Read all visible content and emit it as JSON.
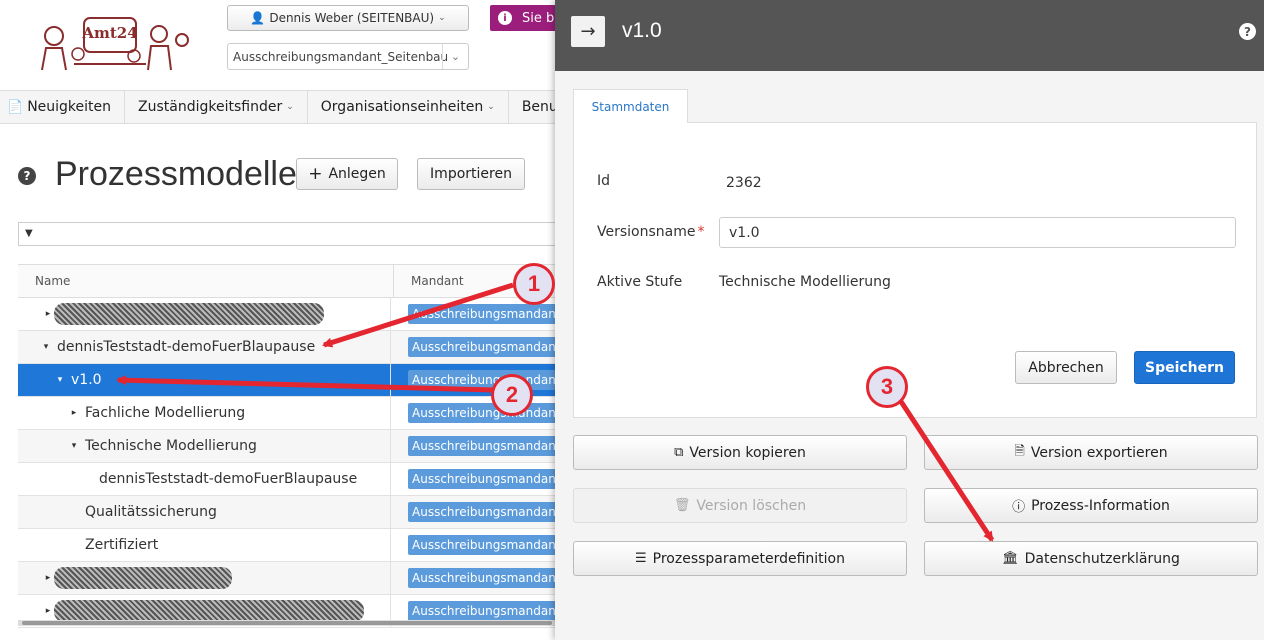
{
  "header": {
    "logo_text": "Amt24",
    "user_button": "Dennis Weber (SEITENBAU)",
    "mandant_select": "Ausschreibungsmandant_Seitenbau",
    "alert_text": "Sie b"
  },
  "nav": [
    {
      "label": "Neuigkeiten",
      "icon": "news-icon"
    },
    {
      "label": "Zuständigkeitsfinder"
    },
    {
      "label": "Organisationseinheiten"
    },
    {
      "label": "Benutzer"
    }
  ],
  "page": {
    "title": "Prozessmodelle",
    "add_button": "Anlegen",
    "import_button": "Importieren"
  },
  "tree": {
    "col_name": "Name",
    "col_mandant": "Mandant",
    "badge": "Ausschreibungsmandant_Seitenbau",
    "rows": [
      {
        "label": "",
        "indent": 0,
        "toggle": "collapsed",
        "redacted": true
      },
      {
        "label": "dennisTeststadt-demoFuerBlaupause",
        "indent": 0,
        "toggle": "expanded"
      },
      {
        "label": "v1.0",
        "indent": 1,
        "toggle": "expanded",
        "selected": true
      },
      {
        "label": "Fachliche Modellierung",
        "indent": 2,
        "toggle": "collapsed"
      },
      {
        "label": "Technische Modellierung",
        "indent": 2,
        "toggle": "expanded"
      },
      {
        "label": "dennisTeststadt-demoFuerBlaupause",
        "indent": 3,
        "toggle": "none"
      },
      {
        "label": "Qualitätssicherung",
        "indent": 2,
        "toggle": "none"
      },
      {
        "label": "Zertifiziert",
        "indent": 2,
        "toggle": "none"
      },
      {
        "label": "",
        "indent": 0,
        "toggle": "collapsed",
        "redacted": true
      },
      {
        "label": "",
        "indent": 0,
        "toggle": "collapsed",
        "redacted": true
      }
    ]
  },
  "panel": {
    "title": "v1.0",
    "tab": "Stammdaten",
    "id_label": "Id",
    "id_value": "2362",
    "version_label": "Versionsname",
    "version_value": "v1.0",
    "stage_label": "Aktive Stufe",
    "stage_value": "Technische Modellierung",
    "cancel": "Abbrechen",
    "save": "Speichern",
    "actions": [
      {
        "label": "Version kopieren",
        "icon": "copy-icon",
        "enabled": true
      },
      {
        "label": "Version exportieren",
        "icon": "export-icon",
        "enabled": true
      },
      {
        "label": "Version löschen",
        "icon": "trash-icon",
        "enabled": false
      },
      {
        "label": "Prozess-Information",
        "icon": "info-icon",
        "enabled": true
      },
      {
        "label": "Prozessparameterdefinition",
        "icon": "list-icon",
        "enabled": true
      },
      {
        "label": "Datenschutzerklärung",
        "icon": "bank-icon",
        "enabled": true
      }
    ]
  },
  "annotations": [
    "1",
    "2",
    "3"
  ],
  "colors": {
    "accent": "#1f75d6",
    "annotation": "#e3262f",
    "alert": "#9b1e7d",
    "panel_header": "#555555"
  }
}
